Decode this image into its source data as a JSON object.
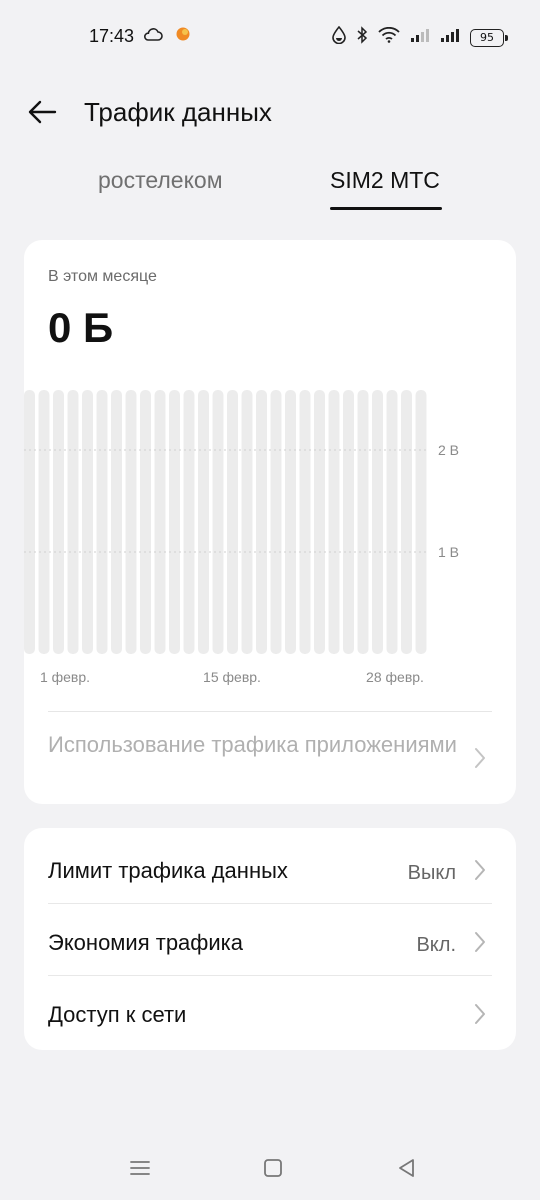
{
  "status_bar": {
    "time": "17:43",
    "battery": "95",
    "icons": [
      "cloud-icon",
      "notification-dot-icon",
      "data-saver-icon",
      "bluetooth-icon",
      "wifi-icon",
      "signal-sim1-icon",
      "signal-sim2-icon",
      "battery-icon"
    ]
  },
  "header": {
    "title": "Трафик данных",
    "back_icon": "back-arrow-icon"
  },
  "tabs": [
    {
      "label": "ростелеком",
      "active": false
    },
    {
      "label": "SIM2 МТС",
      "active": true
    }
  ],
  "usage": {
    "caption": "В этом месяце",
    "value": "0 Б",
    "app_usage_label": "Использование трафика приложениями"
  },
  "chart_data": {
    "type": "bar",
    "categories": [
      "1",
      "2",
      "3",
      "4",
      "5",
      "6",
      "7",
      "8",
      "9",
      "10",
      "11",
      "12",
      "13",
      "14",
      "15",
      "16",
      "17",
      "18",
      "19",
      "20",
      "21",
      "22",
      "23",
      "24",
      "25",
      "26",
      "27",
      "28"
    ],
    "values": [
      0,
      0,
      0,
      0,
      0,
      0,
      0,
      0,
      0,
      0,
      0,
      0,
      0,
      0,
      0,
      0,
      0,
      0,
      0,
      0,
      0,
      0,
      0,
      0,
      0,
      0,
      0,
      0
    ],
    "x_tick_labels": [
      "1 февр.",
      "15 февр.",
      "28 февр."
    ],
    "y_tick_labels": [
      "2 В",
      "1 В"
    ],
    "grid": true,
    "colors": {
      "bar_background": "#ececec",
      "grid": "#cfcfcf"
    }
  },
  "settings": [
    {
      "label": "Лимит трафика данных",
      "value": "Выкл"
    },
    {
      "label": "Экономия трафика",
      "value": "Вкл."
    },
    {
      "label": "Доступ к сети",
      "value": ""
    }
  ],
  "nav_bar": {
    "icons": [
      "menu-icon",
      "home-icon",
      "back-icon"
    ]
  },
  "colors": {
    "background": "#f2f2f4",
    "card": "#ffffff",
    "text_primary": "#111111",
    "text_secondary": "#666666",
    "text_disabled": "#b0b0b0"
  }
}
